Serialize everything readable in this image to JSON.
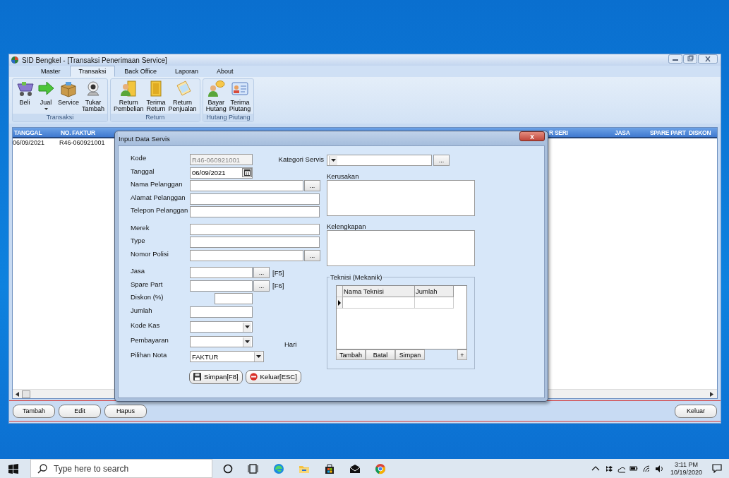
{
  "window": {
    "title": "SID Bengkel - [Transaksi Penerimaan Service]"
  },
  "menu_tabs": [
    {
      "label": "Master",
      "selected": false
    },
    {
      "label": "Transaksi",
      "selected": true
    },
    {
      "label": "Back Office",
      "selected": false
    },
    {
      "label": "Laporan",
      "selected": false
    },
    {
      "label": "About",
      "selected": false
    }
  ],
  "ribbon_groups": [
    {
      "title": "Transaksi",
      "buttons": [
        {
          "label": "Beli",
          "dropdown": false
        },
        {
          "label": "Jual",
          "dropdown": true
        },
        {
          "label": "Service",
          "dropdown": false
        },
        {
          "label": "Tukar Tambah",
          "dropdown": false
        }
      ]
    },
    {
      "title": "Return",
      "buttons": [
        {
          "label": "Return Pembelian",
          "dropdown": false
        },
        {
          "label": "Terima Return",
          "dropdown": false
        },
        {
          "label": "Return Penjualan",
          "dropdown": false
        }
      ]
    },
    {
      "title": "Hutang Piutang",
      "buttons": [
        {
          "label": "Bayar Hutang",
          "dropdown": false
        },
        {
          "label": "Terima Piutang",
          "dropdown": false
        }
      ]
    }
  ],
  "table": {
    "columns": [
      "TANGGAL",
      "NO. FAKTUR",
      "R SERI",
      "JASA",
      "SPARE PART",
      "DISKON"
    ],
    "rows": [
      {
        "cells": [
          "06/09/2021",
          "R46-060921001"
        ],
        "selected": false
      }
    ]
  },
  "bottom_buttons": [
    "Tambah",
    "Edit",
    "Hapus",
    "Keluar"
  ],
  "dialog": {
    "title": "Input Data Servis",
    "close": "x",
    "category_label": "Kategori Servis",
    "fields": [
      {
        "kind": "text",
        "label": "Kode",
        "value": "R46-060921001",
        "disabled": true
      },
      {
        "kind": "date",
        "label": "Tanggal",
        "value": "06/09/2021",
        "disabled": false
      },
      {
        "kind": "lookup",
        "label": "Nama Pelanggan",
        "button": "...",
        "disabled": false
      },
      {
        "kind": "text",
        "label": "Alamat Pelanggan",
        "disabled": false
      },
      {
        "kind": "text",
        "label": "Telepon Pelanggan",
        "disabled": false
      },
      {
        "kind": "text",
        "label": "Merek",
        "disabled": false
      },
      {
        "kind": "text",
        "label": "Type",
        "disabled": false
      },
      {
        "kind": "lookup",
        "label": "Nomor Polisi",
        "button": "...",
        "disabled": false
      },
      {
        "kind": "lookup",
        "label": "Jasa",
        "button": "...",
        "hotkey": "[F5]",
        "disabled": false
      },
      {
        "kind": "lookup",
        "label": "Spare Part",
        "button": "...",
        "hotkey": "[F6]",
        "disabled": false
      },
      {
        "kind": "text",
        "label": "Diskon (%)",
        "disabled": false
      },
      {
        "kind": "text",
        "label": "Jumlah",
        "disabled": false
      },
      {
        "kind": "combo",
        "label": "Kode Kas",
        "disabled": false
      },
      {
        "kind": "combo",
        "label": "Pembayaran",
        "suffix": "Hari",
        "disabled": false
      },
      {
        "kind": "combo",
        "label": "Pilihan Nota",
        "value": "FAKTUR",
        "disabled": false
      }
    ],
    "category_button": "...",
    "memos": [
      {
        "label": "Kerusakan"
      },
      {
        "label": "Kelengkapan"
      }
    ],
    "technicians": {
      "legend": "Teknisi (Mekanik)",
      "columns": [
        "Nama Teknisi",
        "Jumlah"
      ],
      "buttons": [
        "Tambah",
        "Batal",
        "Simpan"
      ],
      "add": "+"
    },
    "actions": [
      {
        "kind": "save",
        "label": "Simpan[F8]"
      },
      {
        "kind": "exit",
        "label": "Keluar[ESC]"
      }
    ]
  },
  "taskbar": {
    "search_placeholder": "Type here to search",
    "time": "3:11 PM",
    "date": "10/19/2020"
  }
}
